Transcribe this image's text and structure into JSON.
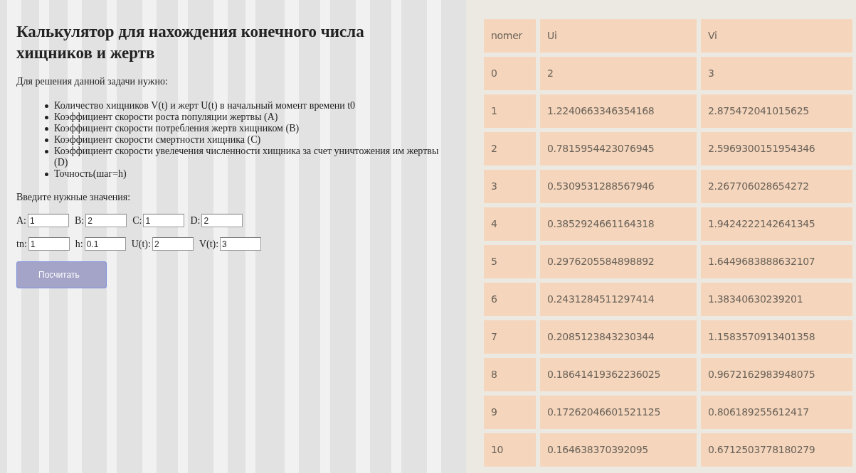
{
  "title": "Калькулятор для нахождения конечного числа хищников и жертв",
  "intro": "Для решения данной задачи нужно:",
  "requirements": [
    "Количество хищников V(t) и жерт U(t) в начальный момент времени t0",
    "Коэффициент скорости роста популяции жертвы (A)",
    "Коэффициент скорости потребления жертв хищником (B)",
    "Коэффициент скорости смертности хищника (C)",
    "Коэффициент скорости увелечения численности хищника за счет уничтожения им жертвы (D)",
    "Точность(шаг=h)"
  ],
  "prompt": "Введите нужные значения:",
  "field_rows": [
    [
      {
        "label": "A:",
        "value": "1"
      },
      {
        "label": "B:",
        "value": "2"
      },
      {
        "label": "C:",
        "value": "1"
      },
      {
        "label": "D:",
        "value": "2"
      }
    ],
    [
      {
        "label": "tn:",
        "value": "1"
      },
      {
        "label": "h:",
        "value": "0.1"
      },
      {
        "label": "U(t):",
        "value": "2"
      },
      {
        "label": "V(t):",
        "value": "3"
      }
    ]
  ],
  "button": "Посчитать",
  "table": {
    "columns": [
      "nomer",
      "Ui",
      "Vi"
    ],
    "rows": [
      [
        "0",
        "2",
        "3"
      ],
      [
        "1",
        "1.2240663346354168",
        "2.875472041015625"
      ],
      [
        "2",
        "0.7815954423076945",
        "2.5969300151954346"
      ],
      [
        "3",
        "0.5309531288567946",
        "2.267706028654272"
      ],
      [
        "4",
        "0.3852924661164318",
        "1.9424222142641345"
      ],
      [
        "5",
        "0.2976205584898892",
        "1.6449683888632107"
      ],
      [
        "6",
        "0.2431284511297414",
        "1.38340630239201"
      ],
      [
        "7",
        "0.2085123843230344",
        "1.1583570913401358"
      ],
      [
        "8",
        "0.18641419362236025",
        "0.9672162983948075"
      ],
      [
        "9",
        "0.17262046601521125",
        "0.806189255612417"
      ],
      [
        "10",
        "0.164638370392095",
        "0.6712503778180279"
      ]
    ]
  }
}
